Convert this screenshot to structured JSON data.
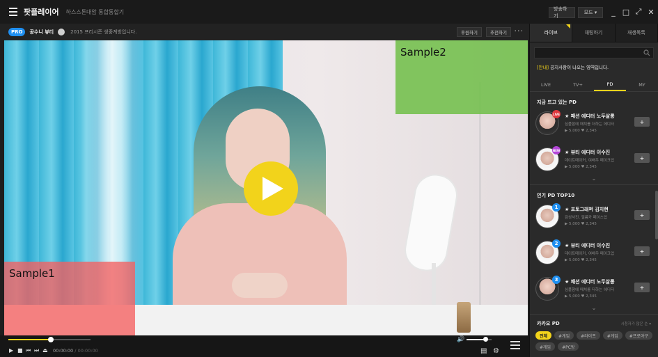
{
  "titlebar": {
    "app_title": "팟플레이어",
    "app_subtitle": "하스스톤대암 통합통합기",
    "btn_broadcast": "방송하기",
    "btn_mode": "모드 ▾",
    "btn_minimize": "_",
    "btn_maximize": "□",
    "btn_fullscreen": "⤢",
    "btn_close": "✕"
  },
  "infobar": {
    "pro_badge": "PRO",
    "channel_name": "공수니 뷰티",
    "broadcast_title": "2015 프리시즌 생중계방입니다.",
    "btn_follow": "후원하기",
    "btn_recommend": "추천하기",
    "more": "···"
  },
  "video": {
    "sample1_label": "Sample1",
    "sample2_label": "Sample2"
  },
  "player": {
    "progress": 0.52,
    "volume": 0.75,
    "time_current": "00:00:00",
    "time_separator": "/",
    "time_total": "00:00:00"
  },
  "sidebar": {
    "tabs": [
      {
        "label": "라이브"
      },
      {
        "label": "채팅하기"
      },
      {
        "label": "재생목록"
      }
    ],
    "search_placeholder": "",
    "notice_tag": "[안내]",
    "notice_text": " 공지사항이 나오는 영역입니다.",
    "sub_tabs": [
      {
        "label": "LIVE"
      },
      {
        "label": "TV+"
      },
      {
        "label": "PD"
      },
      {
        "label": "MY"
      }
    ],
    "section_live_title": "지금 뜨고 있는 PD",
    "live_pds": [
      {
        "badge": "LIVE",
        "badge_color": "#e0383e",
        "name": "★ 패션 에디터 노두살롱",
        "desc": "심플함에 매치를 더하는 에디터",
        "stats": "▶ 5,000  ♥ 2,345"
      },
      {
        "badge": "NEW",
        "badge_color": "#b446d8",
        "name": "★ 뷰티 에디터 이수진",
        "desc": "데이트메이커, 여배우 메이크업",
        "stats": "▶ 5,000  ♥ 2,345"
      }
    ],
    "section_top_title": "인기 PD TOP10",
    "top_pds": [
      {
        "rank": "1",
        "name": "★ 포토그래퍼 김지현",
        "desc": "감성사진, 필름카 페이스업",
        "stats": "▶ 5,000  ♥ 2,345"
      },
      {
        "rank": "2",
        "name": "★ 뷰티 에디터 이수진",
        "desc": "데이트메이커, 여배우 메이크업",
        "stats": "▶ 5,000  ♥ 2,345"
      },
      {
        "rank": "3",
        "name": "★ 패션 에디터 노두살롱",
        "desc": "심플함에 매치를 더하는 에디터",
        "stats": "▶ 5,000  ♥ 2,345"
      }
    ],
    "kakao_title": "카카오 PD",
    "kakao_hint": "시청자가 많은 순 ▾",
    "tags": [
      {
        "label": "전체",
        "active": true
      },
      {
        "label": "#게임",
        "active": false
      },
      {
        "label": "#라이프",
        "active": false
      },
      {
        "label": "#게임",
        "active": false
      },
      {
        "label": "#프로야구",
        "active": false
      },
      {
        "label": "#게임",
        "active": false
      },
      {
        "label": "#PC방",
        "active": false
      }
    ],
    "add_label": "+"
  },
  "colors": {
    "accent_yellow": "#f2d31b",
    "pro_blue": "#1f8ff0",
    "sample1": "#f56060",
    "sample2": "#6ebe46"
  }
}
